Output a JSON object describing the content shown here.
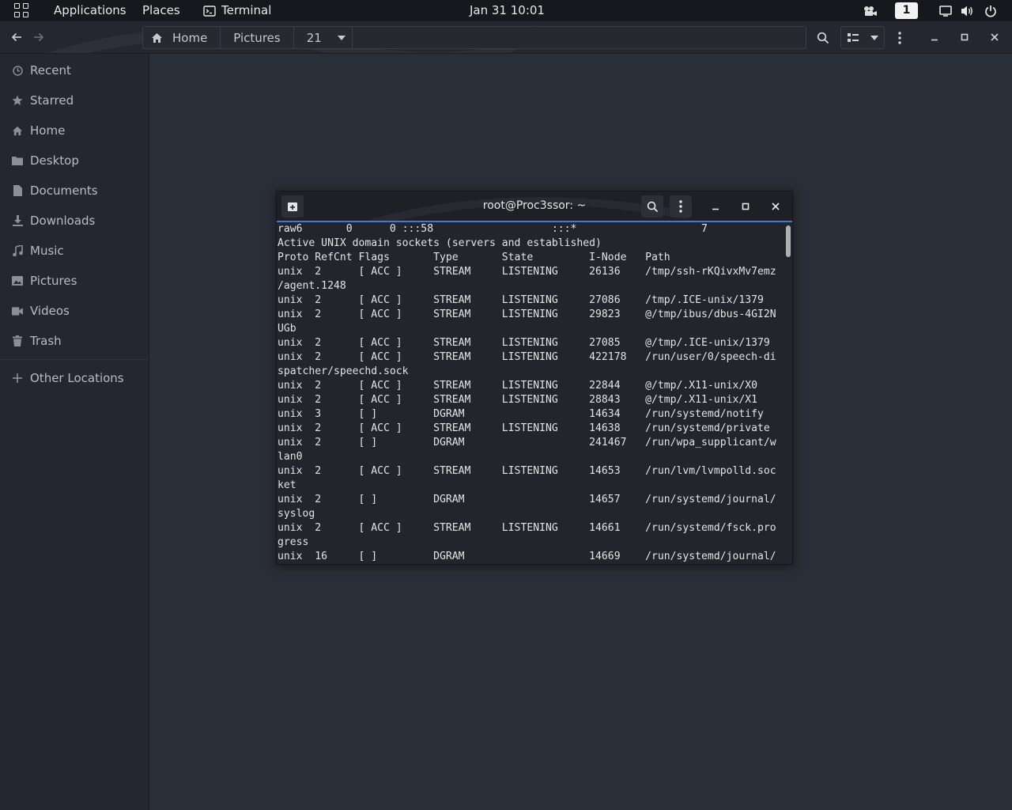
{
  "topbar": {
    "applications": "Applications",
    "places": "Places",
    "terminal_app": "Terminal",
    "clock": "Jan 31  10:01",
    "workspace": "1"
  },
  "pathbar": {
    "crumbs": [
      "Home",
      "Pictures",
      "21"
    ]
  },
  "sidebar": {
    "items": [
      "Recent",
      "Starred",
      "Home",
      "Desktop",
      "Documents",
      "Downloads",
      "Music",
      "Pictures",
      "Videos",
      "Trash"
    ],
    "other": "Other Locations"
  },
  "terminal": {
    "title": "root@Proc3ssor: ~",
    "lines": [
      "raw6       0      0 :::58                   :::*                    7",
      "Active UNIX domain sockets (servers and established)",
      "Proto RefCnt Flags       Type       State         I-Node   Path",
      "unix  2      [ ACC ]     STREAM     LISTENING     26136    /tmp/ssh-rKQivxMv7emz",
      "/agent.1248",
      "unix  2      [ ACC ]     STREAM     LISTENING     27086    /tmp/.ICE-unix/1379",
      "unix  2      [ ACC ]     STREAM     LISTENING     29823    @/tmp/ibus/dbus-4GI2N",
      "UGb",
      "unix  2      [ ACC ]     STREAM     LISTENING     27085    @/tmp/.ICE-unix/1379",
      "unix  2      [ ACC ]     STREAM     LISTENING     422178   /run/user/0/speech-di",
      "spatcher/speechd.sock",
      "unix  2      [ ACC ]     STREAM     LISTENING     22844    @/tmp/.X11-unix/X0",
      "unix  2      [ ACC ]     STREAM     LISTENING     28843    @/tmp/.X11-unix/X1",
      "unix  3      [ ]         DGRAM                    14634    /run/systemd/notify",
      "unix  2      [ ACC ]     STREAM     LISTENING     14638    /run/systemd/private",
      "unix  2      [ ]         DGRAM                    241467   /run/wpa_supplicant/w",
      "lan0",
      "unix  2      [ ACC ]     STREAM     LISTENING     14653    /run/lvm/lvmpolld.soc",
      "ket",
      "unix  2      [ ]         DGRAM                    14657    /run/systemd/journal/",
      "syslog",
      "unix  2      [ ACC ]     STREAM     LISTENING     14661    /run/systemd/fsck.pro",
      "gress",
      "unix  16     [ ]         DGRAM                    14669    /run/systemd/journal/"
    ]
  }
}
